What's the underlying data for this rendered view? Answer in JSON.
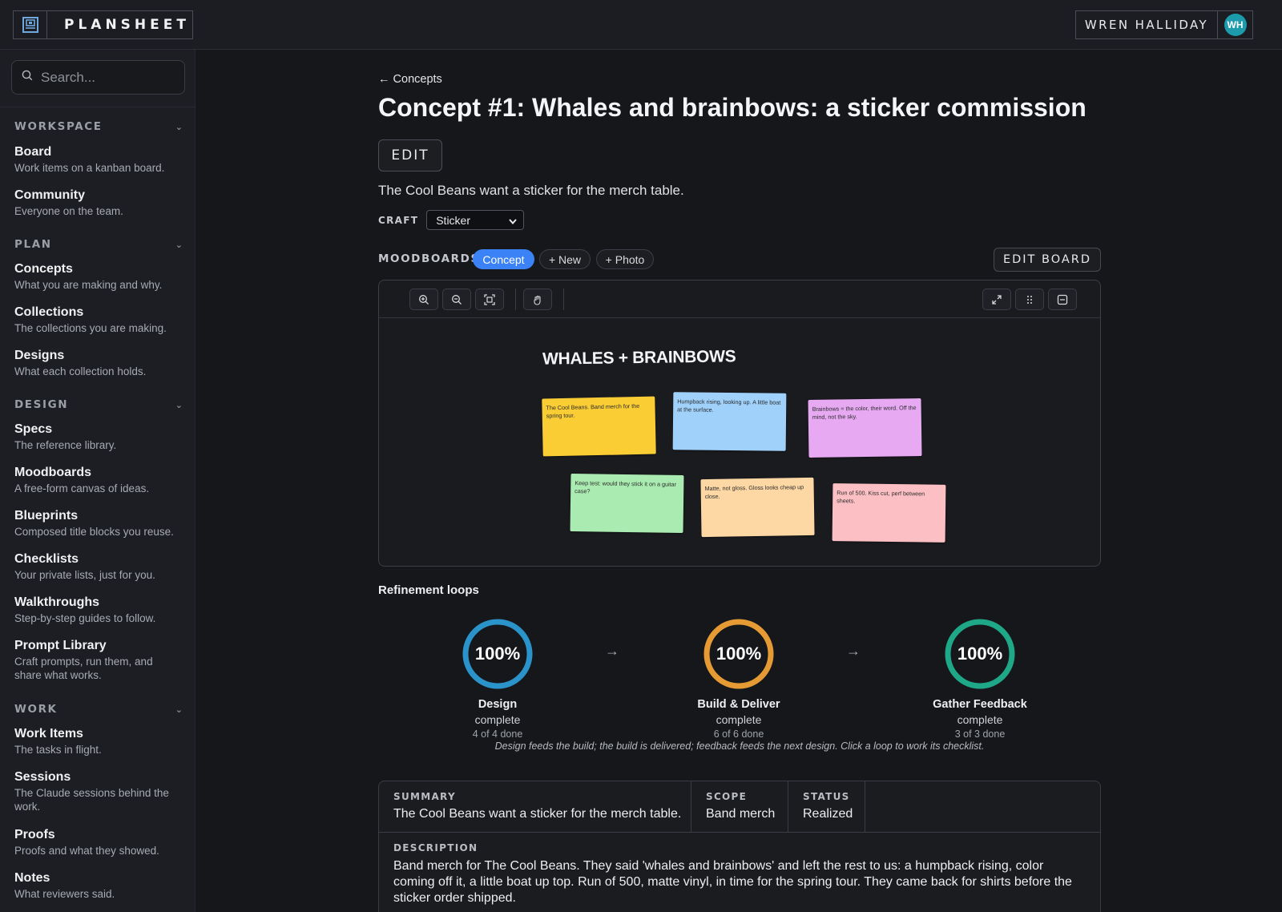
{
  "header": {
    "app_name": "PLANSHEET",
    "user_name": "WREN HALLIDAY",
    "user_initials": "WH",
    "avatar_color": "#1b9bab"
  },
  "sidebar": {
    "search_placeholder": "Search...",
    "sections": [
      {
        "label": "WORKSPACE",
        "items": [
          {
            "label": "Board",
            "desc": "Work items on a kanban board."
          },
          {
            "label": "Community",
            "desc": "Everyone on the team."
          }
        ]
      },
      {
        "label": "PLAN",
        "items": [
          {
            "label": "Concepts",
            "desc": "What you are making and why."
          },
          {
            "label": "Collections",
            "desc": "The collections you are making."
          },
          {
            "label": "Designs",
            "desc": "What each collection holds."
          }
        ]
      },
      {
        "label": "DESIGN",
        "items": [
          {
            "label": "Specs",
            "desc": "The reference library."
          },
          {
            "label": "Moodboards",
            "desc": "A free-form canvas of ideas."
          },
          {
            "label": "Blueprints",
            "desc": "Composed title blocks you reuse."
          },
          {
            "label": "Checklists",
            "desc": "Your private lists, just for you."
          },
          {
            "label": "Walkthroughs",
            "desc": "Step-by-step guides to follow."
          },
          {
            "label": "Prompt Library",
            "desc": "Craft prompts, run them, and share what works."
          }
        ]
      },
      {
        "label": "WORK",
        "items": [
          {
            "label": "Work Items",
            "desc": "The tasks in flight."
          },
          {
            "label": "Sessions",
            "desc": "The Claude sessions behind the work."
          },
          {
            "label": "Proofs",
            "desc": "Proofs and what they showed."
          },
          {
            "label": "Notes",
            "desc": "What reviewers said."
          }
        ]
      }
    ]
  },
  "main": {
    "back_label": "← Concepts",
    "title": "Concept #1: Whales and brainbows: a sticker commission",
    "edit_label": "EDIT",
    "subtitle": "The Cool Beans want a sticker for the merch table.",
    "craft_label": "CRAFT",
    "craft_value": "Sticker",
    "moodboards_label": "MOODBOARDS",
    "pills": {
      "concept": "Concept",
      "new": "+ New",
      "photo": "+ Photo"
    },
    "edit_board_label": "EDIT BOARD",
    "board": {
      "title": "WHALES + BRAINBOWS",
      "stickies": [
        {
          "text": "The Cool Beans. Band merch for the spring tour.",
          "color": "#fbcd34"
        },
        {
          "text": "Humpback rising, looking up. A little boat at the surface.",
          "color": "#9fd1fb"
        },
        {
          "text": "Brainbows = the color, their word. Off the mind, not the sky.",
          "color": "#e6a9f2"
        },
        {
          "text": "Keep test: would they stick it on a guitar case?",
          "color": "#a9ebb0"
        },
        {
          "text": "Matte, not gloss. Gloss looks cheap up close.",
          "color": "#fdd7a4"
        },
        {
          "text": "Run of 500. Kiss cut, perf between sheets.",
          "color": "#fcc0c4"
        }
      ]
    },
    "loops_title": "Refinement loops",
    "loops": [
      {
        "pct": "100%",
        "name": "Design",
        "state": "complete",
        "count": "4 of 4 done",
        "color": "#2a93c9",
        "progress": 1.0
      },
      {
        "pct": "100%",
        "name": "Build & Deliver",
        "state": "complete",
        "count": "6 of 6 done",
        "color": "#e59a34",
        "progress": 1.0
      },
      {
        "pct": "100%",
        "name": "Gather Feedback",
        "state": "complete",
        "count": "3 of 3 done",
        "color": "#1fa887",
        "progress": 1.0
      }
    ],
    "loops_caption": "Design feeds the build; the build is delivered; feedback feeds the next design. Click a loop to work its checklist.",
    "summary": {
      "summary_label": "SUMMARY",
      "summary_value": "The Cool Beans want a sticker for the merch table.",
      "scope_label": "SCOPE",
      "scope_value": "Band merch",
      "status_label": "STATUS",
      "status_value": "Realized",
      "description_label": "DESCRIPTION",
      "description_value": "Band merch for The Cool Beans. They said 'whales and brainbows' and left the rest to us: a humpback rising, color coming off it, a little boat up top. Run of 500, matte vinyl, in time for the spring tour. They came back for shirts before the sticker order shipped."
    }
  }
}
